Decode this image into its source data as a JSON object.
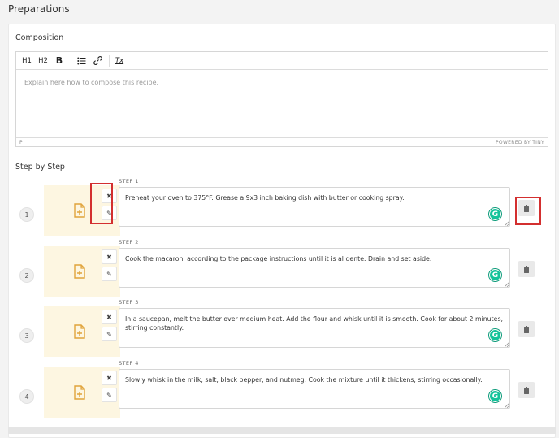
{
  "page": {
    "title": "Preparations"
  },
  "composition": {
    "label": "Composition",
    "toolbar": {
      "h1": "H1",
      "h2": "H2",
      "bold": "B",
      "clear": "Tx"
    },
    "placeholder": "Explain here how to compose this recipe.",
    "status_path": "P",
    "powered_by": "POWERED BY TINY"
  },
  "steps_section": {
    "label": "Step by Step",
    "steps": [
      {
        "number": "1",
        "label": "STEP 1",
        "text": "Preheat your oven to 375°F. Grease a 9x3 inch baking dish with butter or cooking spray."
      },
      {
        "number": "2",
        "label": "STEP 2",
        "text": "Cook the macaroni according to the package instructions until it is al dente. Drain and set aside."
      },
      {
        "number": "3",
        "label": "STEP 3",
        "text": "In a saucepan, melt the butter over medium heat. Add the flour and whisk until it is smooth. Cook for about 2 minutes, stirring constantly."
      },
      {
        "number": "4",
        "label": "STEP 4",
        "text": "Slowly whisk in the milk, salt, black pepper, and nutmeg. Cook the mixture until it thickens, stirring occasionally."
      }
    ]
  },
  "icons": {
    "close": "✖",
    "edit": "✎",
    "grammarly": "G"
  },
  "colors": {
    "accent_highlight": "#d32f2f",
    "media_bg": "#fdf6e1",
    "file_icon": "#e0a33a",
    "grammarly": "#15c39a"
  }
}
